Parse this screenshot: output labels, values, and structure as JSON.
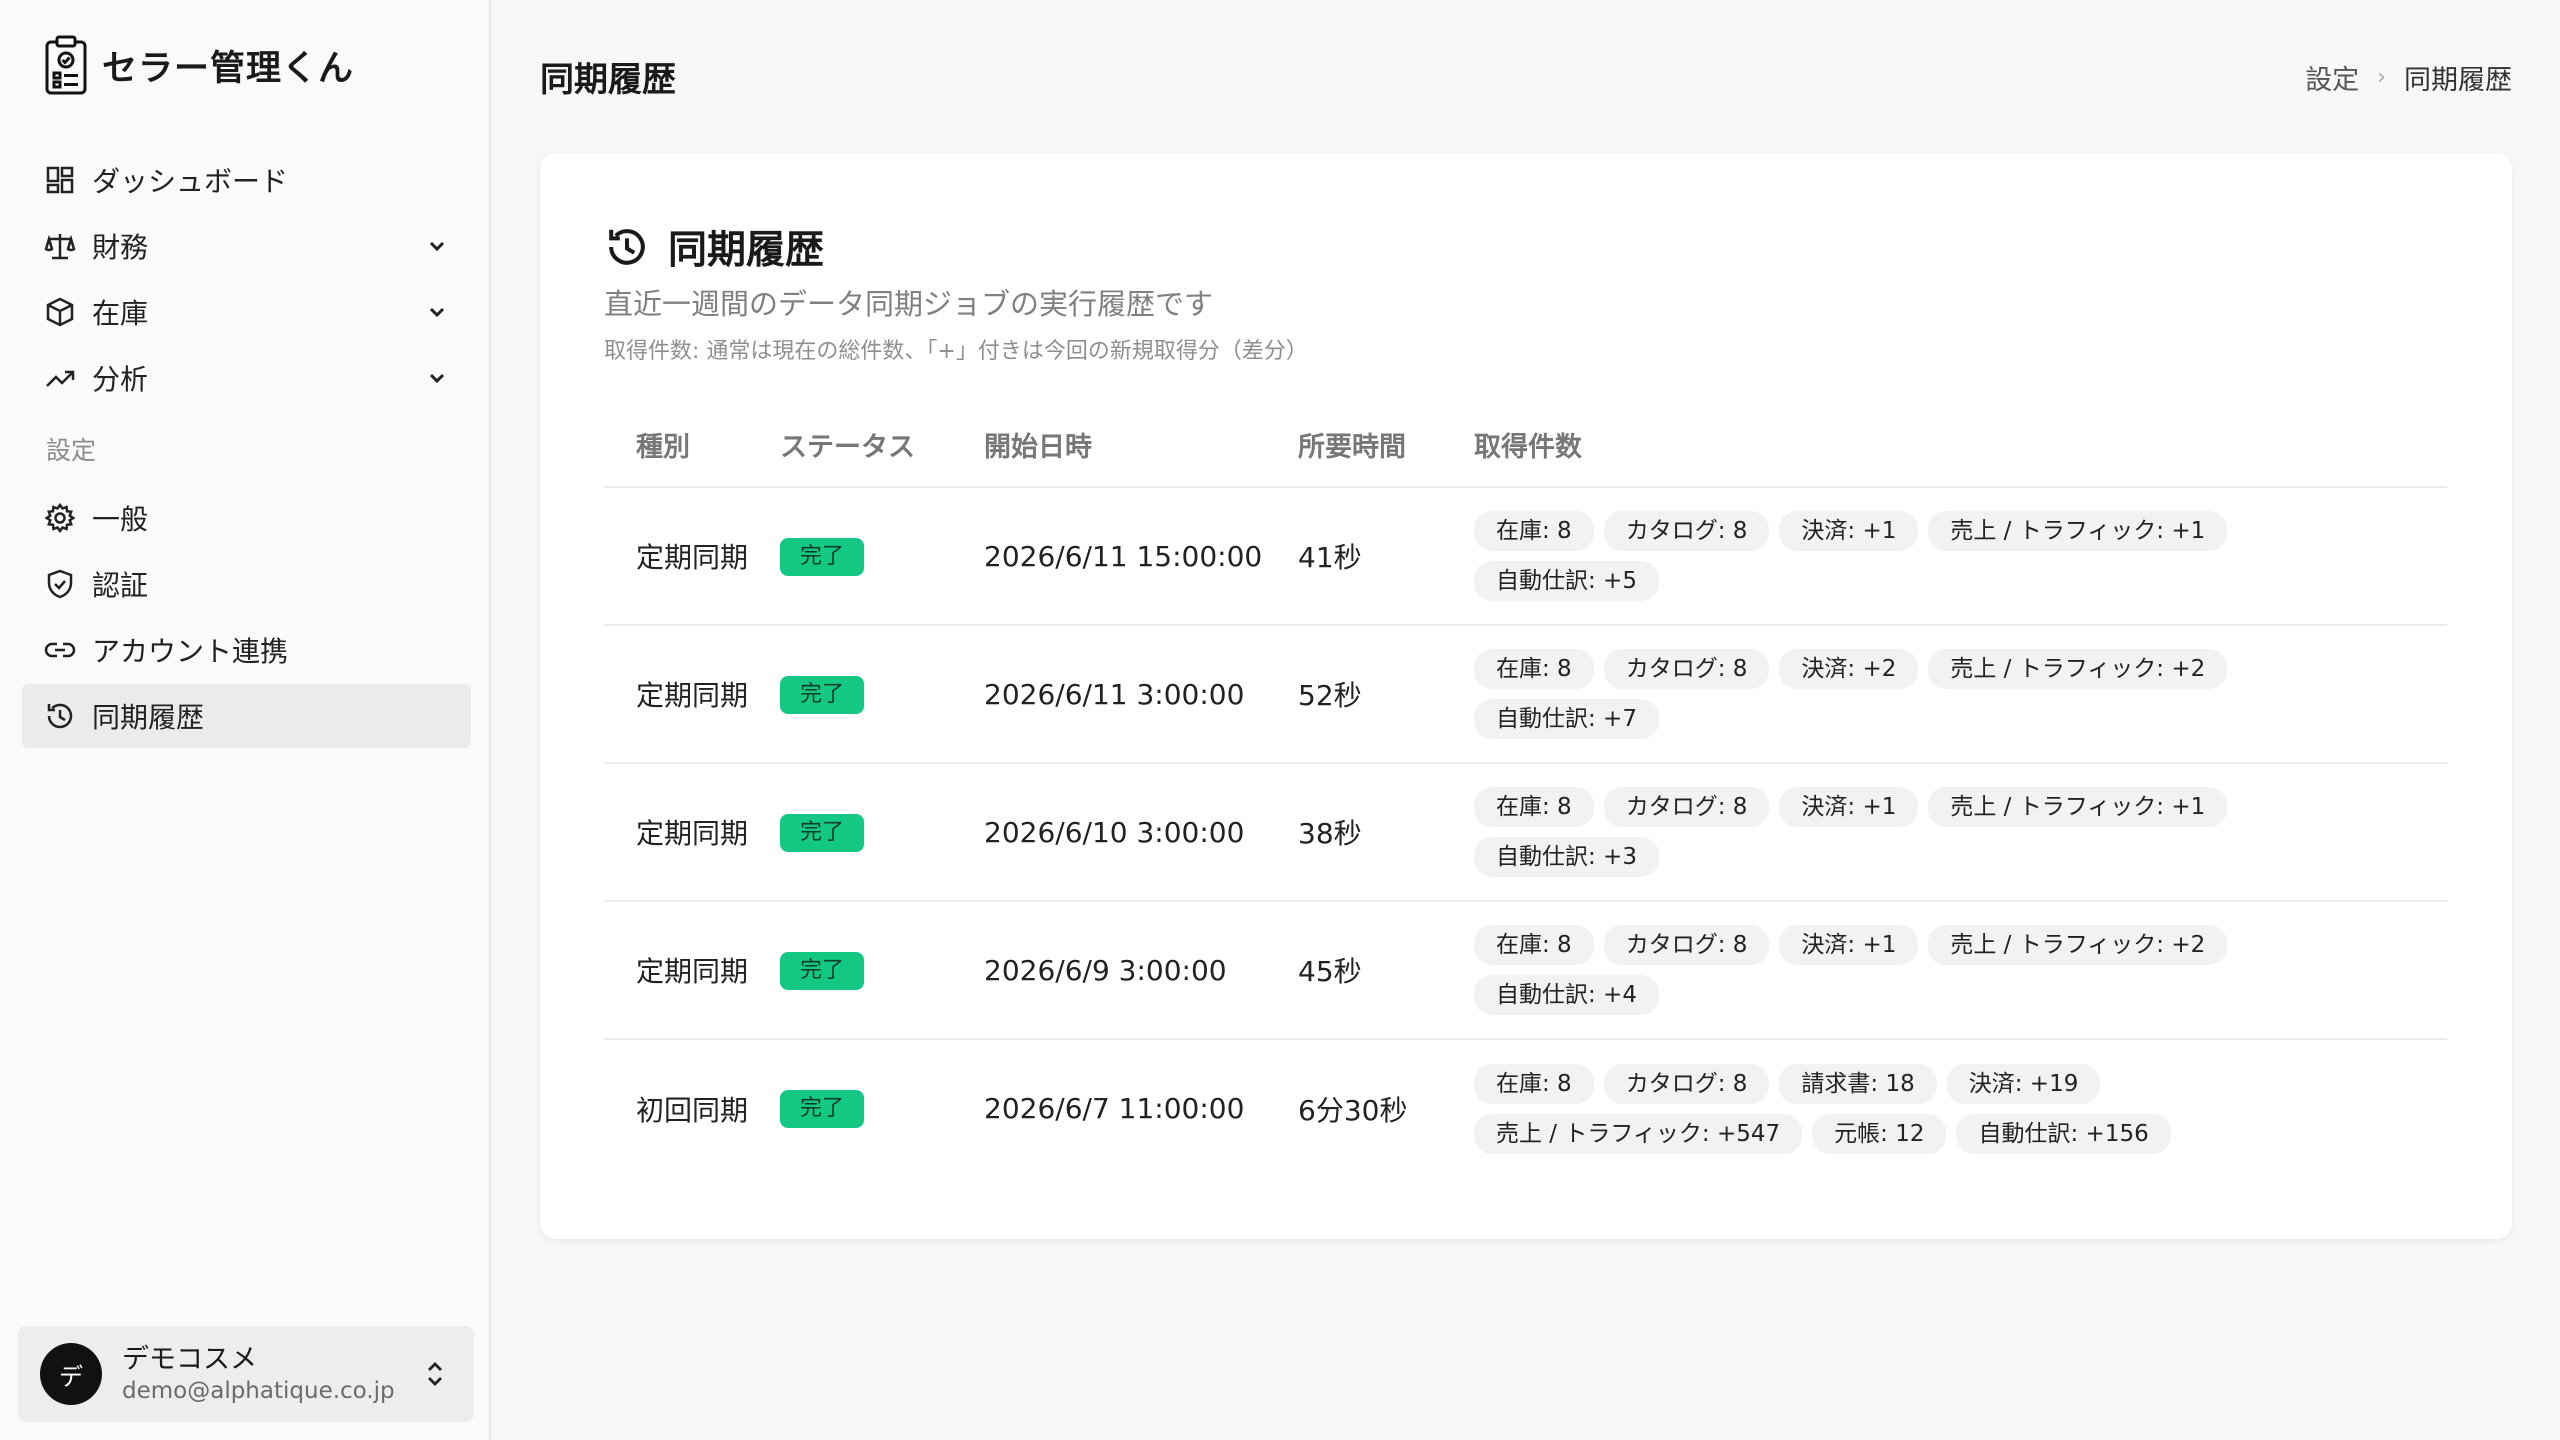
{
  "app": {
    "name": "セラー管理くん"
  },
  "sidebar": {
    "items": [
      {
        "label": "ダッシュボード"
      },
      {
        "label": "財務"
      },
      {
        "label": "在庫"
      },
      {
        "label": "分析"
      }
    ],
    "section_label": "設定",
    "settings_items": [
      {
        "label": "一般"
      },
      {
        "label": "認証"
      },
      {
        "label": "アカウント連携"
      },
      {
        "label": "同期履歴"
      }
    ]
  },
  "user": {
    "initial": "デ",
    "name": "デモコスメ",
    "email": "demo@alphatique.co.jp"
  },
  "header": {
    "title": "同期履歴",
    "breadcrumb": {
      "parent": "設定",
      "sep": "›",
      "current": "同期履歴"
    }
  },
  "card": {
    "title": "同期履歴",
    "description": "直近一週間のデータ同期ジョブの実行履歴です",
    "note": "取得件数: 通常は現在の総件数、「+」付きは今回の新規取得分（差分）"
  },
  "table": {
    "headers": {
      "type": "種別",
      "status": "ステータス",
      "start": "開始日時",
      "duration": "所要時間",
      "counts": "取得件数"
    },
    "rows": [
      {
        "type": "定期同期",
        "status": "完了",
        "start": "2026/6/11 15:00:00",
        "duration": "41秒",
        "counts": [
          "在庫: 8",
          "カタログ: 8",
          "決済: +1",
          "売上 / トラフィック: +1",
          "自動仕訳: +5"
        ]
      },
      {
        "type": "定期同期",
        "status": "完了",
        "start": "2026/6/11 3:00:00",
        "duration": "52秒",
        "counts": [
          "在庫: 8",
          "カタログ: 8",
          "決済: +2",
          "売上 / トラフィック: +2",
          "自動仕訳: +7"
        ]
      },
      {
        "type": "定期同期",
        "status": "完了",
        "start": "2026/6/10 3:00:00",
        "duration": "38秒",
        "counts": [
          "在庫: 8",
          "カタログ: 8",
          "決済: +1",
          "売上 / トラフィック: +1",
          "自動仕訳: +3"
        ]
      },
      {
        "type": "定期同期",
        "status": "完了",
        "start": "2026/6/9 3:00:00",
        "duration": "45秒",
        "counts": [
          "在庫: 8",
          "カタログ: 8",
          "決済: +1",
          "売上 / トラフィック: +2",
          "自動仕訳: +4"
        ]
      },
      {
        "type": "初回同期",
        "status": "完了",
        "start": "2026/6/7 11:00:00",
        "duration": "6分30秒",
        "counts": [
          "在庫: 8",
          "カタログ: 8",
          "請求書: 18",
          "決済: +19",
          "売上 / トラフィック: +547",
          "元帳: 12",
          "自動仕訳: +156"
        ]
      }
    ]
  },
  "colors": {
    "status_complete": "#12c882",
    "active_nav_bg": "#ebebeb"
  }
}
